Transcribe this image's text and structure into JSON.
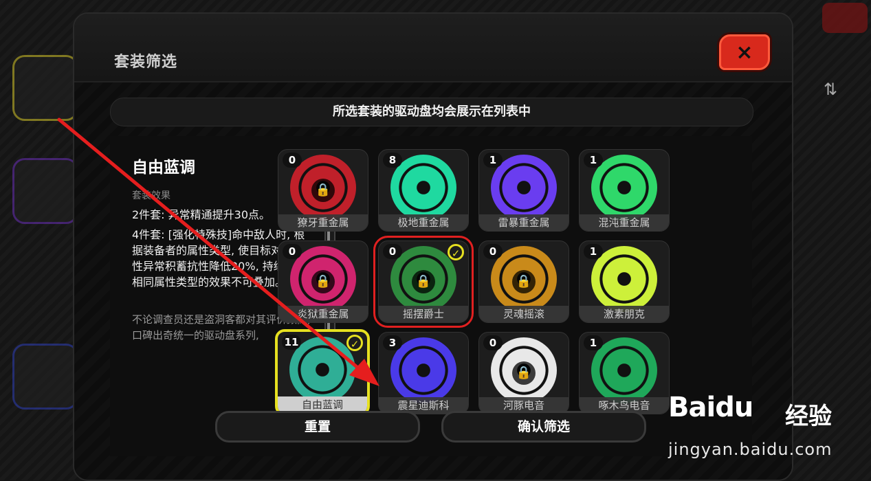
{
  "panel": {
    "title": "套装筛选",
    "close_icon": "×",
    "notice": "所选套装的驱动盘均会展示在列表中"
  },
  "detail": {
    "set_name": "自由蓝调",
    "effect_label": "套装效果",
    "effect_2pc": "2件套: 异常精通提升30点。",
    "effect_4pc": "4件套: [强化特殊技]命中敌人时, 根据装备者的属性类型, 使目标对应属性异常积蓄抗性降低20%, 持续8秒, 相同属性类型的效果不可叠加。",
    "lore": "不论调查员还是盗洞客都对其评价颇高, 口碑出奇统一的驱动盘系列,"
  },
  "cards": [
    {
      "name": "獠牙重金属",
      "count": "0",
      "locked": true,
      "color": "#c0202a"
    },
    {
      "name": "极地重金属",
      "count": "8",
      "locked": false,
      "color": "#1fd9a0"
    },
    {
      "name": "雷暴重金属",
      "count": "1",
      "locked": false,
      "color": "#6a3df0"
    },
    {
      "name": "混沌重金属",
      "count": "1",
      "locked": false,
      "color": "#2fd86a"
    },
    {
      "name": "炎狱重金属",
      "count": "0",
      "locked": true,
      "color": "#d0246e"
    },
    {
      "name": "摇摆爵士",
      "count": "0",
      "locked": true,
      "color": "#2e8a3e"
    },
    {
      "name": "灵魂摇滚",
      "count": "0",
      "locked": true,
      "color": "#c98a1a"
    },
    {
      "name": "激素朋克",
      "count": "1",
      "locked": false,
      "color": "#cdf03a"
    },
    {
      "name": "自由蓝调",
      "count": "11",
      "locked": false,
      "color": "#2fae96"
    },
    {
      "name": "震星迪斯科",
      "count": "3",
      "locked": false,
      "color": "#4a3ae8"
    },
    {
      "name": "河豚电音",
      "count": "0",
      "locked": true,
      "color": "#e8e8e8"
    },
    {
      "name": "啄木鸟电音",
      "count": "1",
      "locked": false,
      "color": "#1fa85a"
    }
  ],
  "buttons": {
    "reset": "重置",
    "confirm": "确认筛选"
  },
  "icons": {
    "lock": "lock-icon",
    "check": "checkmark-icon",
    "sort": "sort-icon"
  },
  "watermark": {
    "logo_bai": "Bai",
    "logo_du": "du",
    "cn": "经验",
    "url": "jingyan.baidu.com"
  }
}
